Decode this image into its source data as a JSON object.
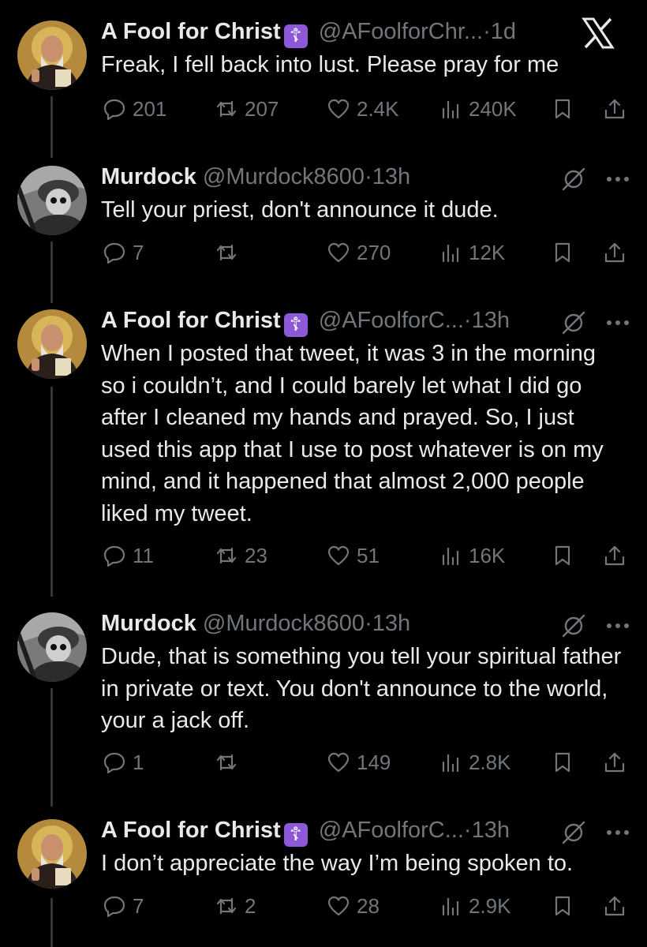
{
  "header": {
    "close_icon": "x-logo"
  },
  "tweets": [
    {
      "name": "A Fool for Christ",
      "badge": "☦",
      "handle": "@AFoolforChr...",
      "sep": "·",
      "time": "1d",
      "text": "Freak, I fell back into lust. Please pray for me",
      "replies": "201",
      "retweets": "207",
      "likes": "2.4K",
      "views": "240K"
    },
    {
      "name": "Murdock",
      "handle": "@Murdock8600",
      "sep": "·",
      "time": "13h",
      "text": "Tell your priest, don't announce it dude.",
      "replies": "7",
      "retweets": "",
      "likes": "270",
      "views": "12K"
    },
    {
      "name": "A Fool for Christ",
      "badge": "☦",
      "handle": "@AFoolforC...",
      "sep": "·",
      "time": "13h",
      "text": "When I posted that tweet, it was 3 in the morning so i couldn’t, and I could barely let what I did go after I cleaned my hands and prayed. So, I just used this app that I use to post whatever is on my mind, and it happened that almost 2,000 people liked my tweet.",
      "replies": "11",
      "retweets": "23",
      "likes": "51",
      "views": "16K"
    },
    {
      "name": "Murdock",
      "handle": "@Murdock8600",
      "sep": "·",
      "time": "13h",
      "text": "Dude, that is something you tell your spiritual father in private or text. You don't announce to the world, your a jack off.",
      "replies": "1",
      "retweets": "",
      "likes": "149",
      "views": "2.8K"
    },
    {
      "name": "A Fool for Christ",
      "badge": "☦",
      "handle": "@AFoolforC...",
      "sep": "·",
      "time": "13h",
      "text": "I don’t appreciate the way I’m being spoken to.",
      "replies": "7",
      "retweets": "2",
      "likes": "28",
      "views": "2.9K"
    }
  ]
}
